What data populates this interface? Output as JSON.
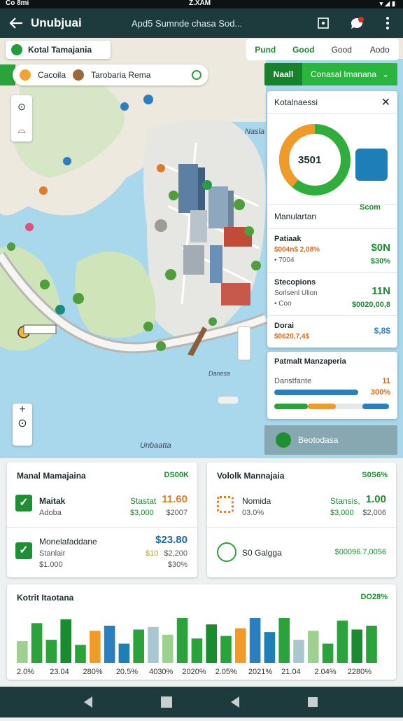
{
  "status_bar": {
    "left": "Co 8mi",
    "center": "Z.XAM"
  },
  "app_bar": {
    "title": "Unubjuai",
    "subtitle": "Apd5  Sumnde chasa Sod..."
  },
  "location_pill": {
    "label": "Kotal Tamajania"
  },
  "view_tabs": [
    "Pund",
    "Good",
    "Good",
    "Aodo"
  ],
  "search": {
    "item1": "Cacoila",
    "item2": "Tarobaria Rema"
  },
  "segment": {
    "left": "Naall",
    "right": "Conasal Imanana"
  },
  "map_labels": {
    "label1": "Nasla",
    "label2": "Unbaatta",
    "label3": "Danesa"
  },
  "side_panel": {
    "title": "Kotalnaessi",
    "donut_value": "3501",
    "logo_caption": "Scom",
    "section_label": "Manulartan",
    "rows": [
      {
        "title": "Patiaak",
        "value": "$004n$ 2,08%",
        "sub": "• 7004",
        "right1": "$0N",
        "right2": "$30%"
      },
      {
        "title": "Stecopions",
        "value": "Sorlsenl Ulion",
        "sub": "• Coo",
        "right1": "11N",
        "right2": "$0020,00,8"
      },
      {
        "title": "Dorai",
        "value": "$0620,7,4$",
        "sub": "",
        "right1": "$,8$",
        "right2": ""
      }
    ]
  },
  "progress_panel": {
    "title": "Patmalt Manzaperia",
    "left_label": "Danstfante",
    "right_label": "11",
    "right_value": "300%",
    "progress": 0.78
  },
  "footer_panel": {
    "label": "Beotodasa"
  },
  "card1": {
    "title": "Manal Mamajaina",
    "value": "DS00K",
    "rows": [
      {
        "title": "Maitak",
        "sub": "Adoba",
        "right_label": "Stastat",
        "right_value": "11.60",
        "right_sub1": "$3,000",
        "right_sub2": "$2007"
      },
      {
        "title": "Monelafaddane",
        "sub": "Stanlair",
        "sub2": "$1.000",
        "right_value": "$23.80",
        "right_sub1": "$10",
        "right_sub2": "$2,200",
        "right_sub3": "$30%"
      }
    ]
  },
  "card2": {
    "title": "Vololk Mannajaia",
    "value": "S0S6%",
    "rows": [
      {
        "title": "Nomida",
        "sub": "03.0%",
        "right_label": "Stansis,",
        "right_value": "1.00",
        "right_sub1": "$3,000",
        "right_sub2": "$2,006"
      },
      {
        "title": "S0 Galgga",
        "right_value": "$00096.7,0056"
      }
    ]
  },
  "card3": {
    "title": "Kotrit Itaotana",
    "value": "DO28%",
    "chart_data": {
      "type": "bar",
      "categories": [
        "2.0%",
        "23.04",
        "280%",
        "20.5%",
        "4030%",
        "2020%",
        "2.05%",
        "2021%",
        "21.04",
        "2.04%",
        "2280%"
      ],
      "values": [
        34,
        62,
        36,
        68,
        28,
        50,
        58,
        30,
        52,
        56,
        44,
        70,
        38,
        60,
        42,
        54,
        70,
        48,
        70,
        36,
        50,
        30,
        66,
        52,
        58
      ]
    }
  },
  "nav": [
    "back-icon",
    "home-icon",
    "recents-icon"
  ]
}
